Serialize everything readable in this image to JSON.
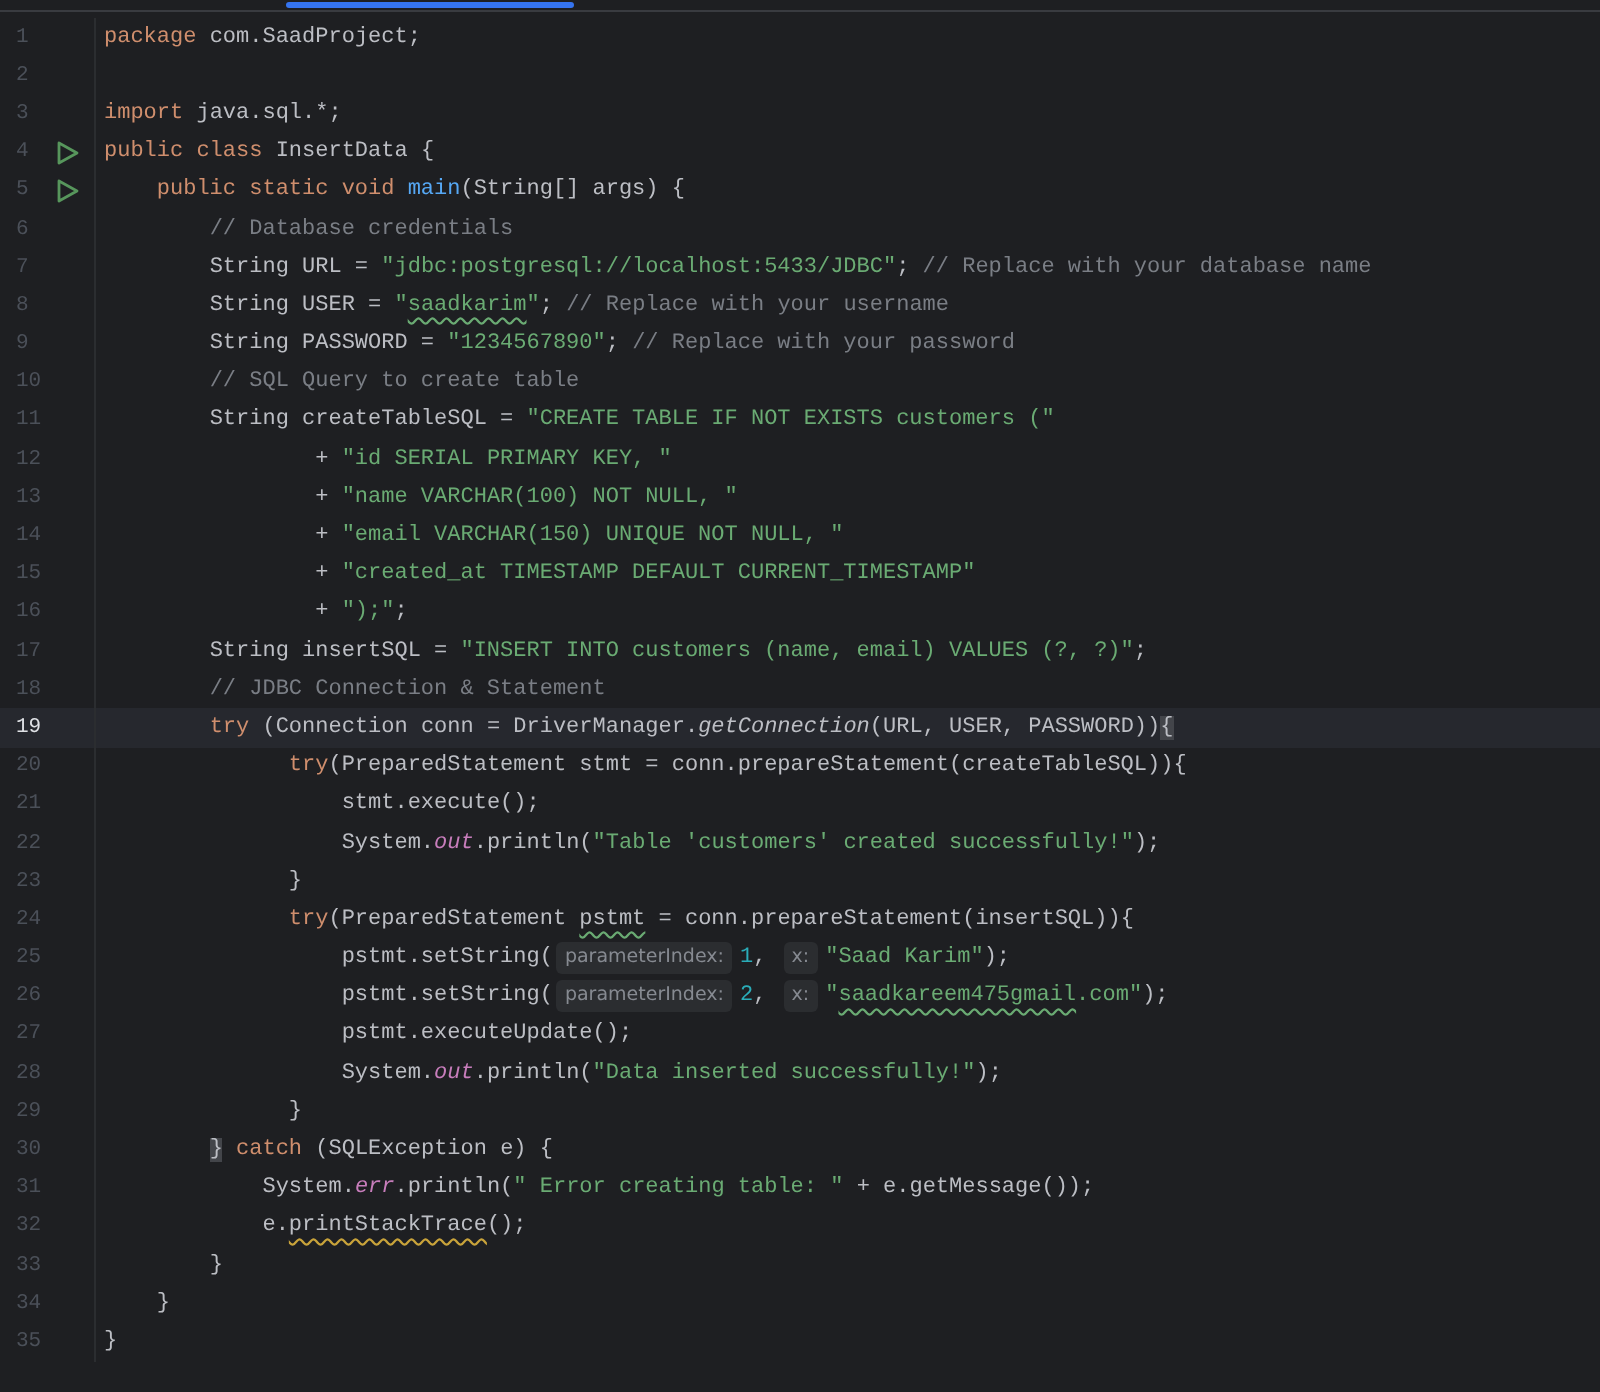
{
  "editor": {
    "lines": [
      {
        "number": "1",
        "run": false,
        "current": false,
        "tokens": [
          {
            "kind": "keyword",
            "text": "package"
          },
          {
            "kind": "plain",
            "text": " com.SaadProject;"
          }
        ]
      },
      {
        "number": "2",
        "run": false,
        "current": false
      },
      {
        "number": "3",
        "run": false,
        "current": false,
        "tokens": [
          {
            "kind": "keyword",
            "text": "import"
          },
          {
            "kind": "plain",
            "text": " java.sql.*;"
          }
        ]
      },
      {
        "number": "4",
        "run": true,
        "current": false,
        "tokens": [
          {
            "kind": "keyword",
            "text": "public class"
          },
          {
            "kind": "plain",
            "text": " InsertData {"
          }
        ]
      },
      {
        "number": "5",
        "run": true,
        "current": false,
        "tokens": [
          {
            "kind": "keyword",
            "text": "    public static void "
          },
          {
            "kind": "declaration",
            "text": "main"
          },
          {
            "kind": "plain",
            "text": "(String[] args) {"
          }
        ]
      },
      {
        "number": "6",
        "run": false,
        "current": false,
        "tokens": [
          {
            "kind": "comment",
            "text": "        // Database credentials"
          }
        ]
      },
      {
        "number": "7",
        "run": false,
        "current": false,
        "tokens": [
          {
            "kind": "plain",
            "text": "        String URL = "
          },
          {
            "kind": "string",
            "text": "\"jdbc:postgresql://localhost:5433/JDBC\""
          },
          {
            "kind": "plain",
            "text": "; "
          },
          {
            "kind": "comment",
            "text": "// Replace with your database name"
          }
        ]
      },
      {
        "number": "8",
        "run": false,
        "current": false,
        "tokens": [
          {
            "kind": "plain",
            "text": "        String USER = "
          },
          {
            "kind": "string",
            "text": "\""
          },
          {
            "kind": "string-typo",
            "text": "saadkarim"
          },
          {
            "kind": "string",
            "text": "\""
          },
          {
            "kind": "plain",
            "text": "; "
          },
          {
            "kind": "comment",
            "text": "// Replace with your username"
          }
        ]
      },
      {
        "number": "9",
        "run": false,
        "current": false,
        "tokens": [
          {
            "kind": "plain",
            "text": "        String PASSWORD = "
          },
          {
            "kind": "string",
            "text": "\"1234567890\""
          },
          {
            "kind": "plain",
            "text": "; "
          },
          {
            "kind": "comment",
            "text": "// Replace with your password"
          }
        ]
      },
      {
        "number": "10",
        "run": false,
        "current": false,
        "tokens": [
          {
            "kind": "comment",
            "text": "        // SQL Query to create table"
          }
        ]
      },
      {
        "number": "11",
        "run": false,
        "current": false,
        "tokens": [
          {
            "kind": "plain",
            "text": "        String createTableSQL = "
          },
          {
            "kind": "string",
            "text": "\"CREATE TABLE IF NOT EXISTS customers (\""
          }
        ]
      },
      {
        "number": "12",
        "run": false,
        "current": false,
        "tokens": [
          {
            "kind": "plain",
            "text": "                + "
          },
          {
            "kind": "string",
            "text": "\"id SERIAL PRIMARY KEY, \""
          }
        ]
      },
      {
        "number": "13",
        "run": false,
        "current": false,
        "tokens": [
          {
            "kind": "plain",
            "text": "                + "
          },
          {
            "kind": "string",
            "text": "\"name VARCHAR(100) NOT NULL, \""
          }
        ]
      },
      {
        "number": "14",
        "run": false,
        "current": false,
        "tokens": [
          {
            "kind": "plain",
            "text": "                + "
          },
          {
            "kind": "string",
            "text": "\"email VARCHAR(150) UNIQUE NOT NULL, \""
          }
        ]
      },
      {
        "number": "15",
        "run": false,
        "current": false,
        "tokens": [
          {
            "kind": "plain",
            "text": "                + "
          },
          {
            "kind": "string",
            "text": "\"created_at TIMESTAMP DEFAULT CURRENT_TIMESTAMP\""
          }
        ]
      },
      {
        "number": "16",
        "run": false,
        "current": false,
        "tokens": [
          {
            "kind": "plain",
            "text": "                + "
          },
          {
            "kind": "string",
            "text": "\");\""
          },
          {
            "kind": "plain",
            "text": ";"
          }
        ]
      },
      {
        "number": "17",
        "run": false,
        "current": false,
        "tokens": [
          {
            "kind": "plain",
            "text": "        String insertSQL = "
          },
          {
            "kind": "string",
            "text": "\"INSERT INTO customers (name, email) VALUES (?, ?)\""
          },
          {
            "kind": "plain",
            "text": ";"
          }
        ]
      },
      {
        "number": "18",
        "run": false,
        "current": false,
        "tokens": [
          {
            "kind": "comment",
            "text": "        // JDBC Connection & Statement"
          }
        ]
      },
      {
        "number": "19",
        "run": false,
        "current": true,
        "tokens": [
          {
            "kind": "keyword",
            "text": "        try"
          },
          {
            "kind": "plain",
            "text": " (Connection conn = DriverManager."
          },
          {
            "kind": "static-call",
            "text": "getConnection"
          },
          {
            "kind": "plain",
            "text": "(URL, USER, PASSWORD))"
          },
          {
            "kind": "matched-brace",
            "text": "{"
          }
        ]
      },
      {
        "number": "20",
        "run": false,
        "current": false,
        "tokens": [
          {
            "kind": "keyword",
            "text": "              try"
          },
          {
            "kind": "plain",
            "text": "(PreparedStatement stmt = conn.prepareStatement(createTableSQL)){"
          }
        ]
      },
      {
        "number": "21",
        "run": false,
        "current": false,
        "tokens": [
          {
            "kind": "plain",
            "text": "                  stmt.execute();"
          }
        ]
      },
      {
        "number": "22",
        "run": false,
        "current": false,
        "tokens": [
          {
            "kind": "plain",
            "text": "                  System."
          },
          {
            "kind": "static-field",
            "text": "out"
          },
          {
            "kind": "plain",
            "text": ".println("
          },
          {
            "kind": "string",
            "text": "\"Table 'customers' created successfully!\""
          },
          {
            "kind": "plain",
            "text": ");"
          }
        ]
      },
      {
        "number": "23",
        "run": false,
        "current": false,
        "tokens": [
          {
            "kind": "plain",
            "text": "              }"
          }
        ]
      },
      {
        "number": "24",
        "run": false,
        "current": false,
        "tokens": [
          {
            "kind": "keyword",
            "text": "              try"
          },
          {
            "kind": "plain",
            "text": "(PreparedStatement "
          },
          {
            "kind": "plain-typo",
            "text": "pstmt"
          },
          {
            "kind": "plain",
            "text": " = conn.prepareStatement(insertSQL)){"
          }
        ]
      },
      {
        "number": "25",
        "run": false,
        "current": false,
        "tokens": [
          {
            "kind": "plain",
            "text": "                  pstmt.setString("
          },
          {
            "kind": "hint",
            "text": "parameterIndex:"
          },
          {
            "kind": "number",
            "text": "1"
          },
          {
            "kind": "plain",
            "text": ", "
          },
          {
            "kind": "hint",
            "text": "x:"
          },
          {
            "kind": "string",
            "text": "\"Saad Karim\""
          },
          {
            "kind": "plain",
            "text": ");"
          }
        ]
      },
      {
        "number": "26",
        "run": false,
        "current": false,
        "tokens": [
          {
            "kind": "plain",
            "text": "                  pstmt.setString("
          },
          {
            "kind": "hint",
            "text": "parameterIndex:"
          },
          {
            "kind": "number",
            "text": "2"
          },
          {
            "kind": "plain",
            "text": ", "
          },
          {
            "kind": "hint",
            "text": "x:"
          },
          {
            "kind": "string",
            "text": "\""
          },
          {
            "kind": "string-typo",
            "text": "saadkareem475gmail"
          },
          {
            "kind": "string",
            "text": ".com\""
          },
          {
            "kind": "plain",
            "text": ");"
          }
        ]
      },
      {
        "number": "27",
        "run": false,
        "current": false,
        "tokens": [
          {
            "kind": "plain",
            "text": "                  pstmt.executeUpdate();"
          }
        ]
      },
      {
        "number": "28",
        "run": false,
        "current": false,
        "tokens": [
          {
            "kind": "plain",
            "text": "                  System."
          },
          {
            "kind": "static-field",
            "text": "out"
          },
          {
            "kind": "plain",
            "text": ".println("
          },
          {
            "kind": "string",
            "text": "\"Data inserted successfully!\""
          },
          {
            "kind": "plain",
            "text": ");"
          }
        ]
      },
      {
        "number": "29",
        "run": false,
        "current": false,
        "tokens": [
          {
            "kind": "plain",
            "text": "              }"
          }
        ]
      },
      {
        "number": "30",
        "run": false,
        "current": false,
        "tokens": [
          {
            "kind": "matched-brace",
            "text": "        }"
          },
          {
            "kind": "keyword",
            "text": " catch"
          },
          {
            "kind": "plain",
            "text": " (SQLException e) {"
          }
        ]
      },
      {
        "number": "31",
        "run": false,
        "current": false,
        "tokens": [
          {
            "kind": "plain",
            "text": "            System."
          },
          {
            "kind": "static-field",
            "text": "err"
          },
          {
            "kind": "plain",
            "text": ".println("
          },
          {
            "kind": "string",
            "text": "\" Error creating table: \""
          },
          {
            "kind": "plain",
            "text": " + e.getMessage());"
          }
        ]
      },
      {
        "number": "32",
        "run": false,
        "current": false,
        "tokens": [
          {
            "kind": "plain",
            "text": "            e."
          },
          {
            "kind": "warning",
            "text": "printStackTrace"
          },
          {
            "kind": "plain",
            "text": "();"
          }
        ]
      },
      {
        "number": "33",
        "run": false,
        "current": false,
        "tokens": [
          {
            "kind": "plain",
            "text": "        }"
          }
        ]
      },
      {
        "number": "34",
        "run": false,
        "current": false,
        "tokens": [
          {
            "kind": "plain",
            "text": "    }"
          }
        ]
      },
      {
        "number": "35",
        "run": false,
        "current": false,
        "tokens": [
          {
            "kind": "plain",
            "text": "}"
          }
        ]
      }
    ]
  }
}
